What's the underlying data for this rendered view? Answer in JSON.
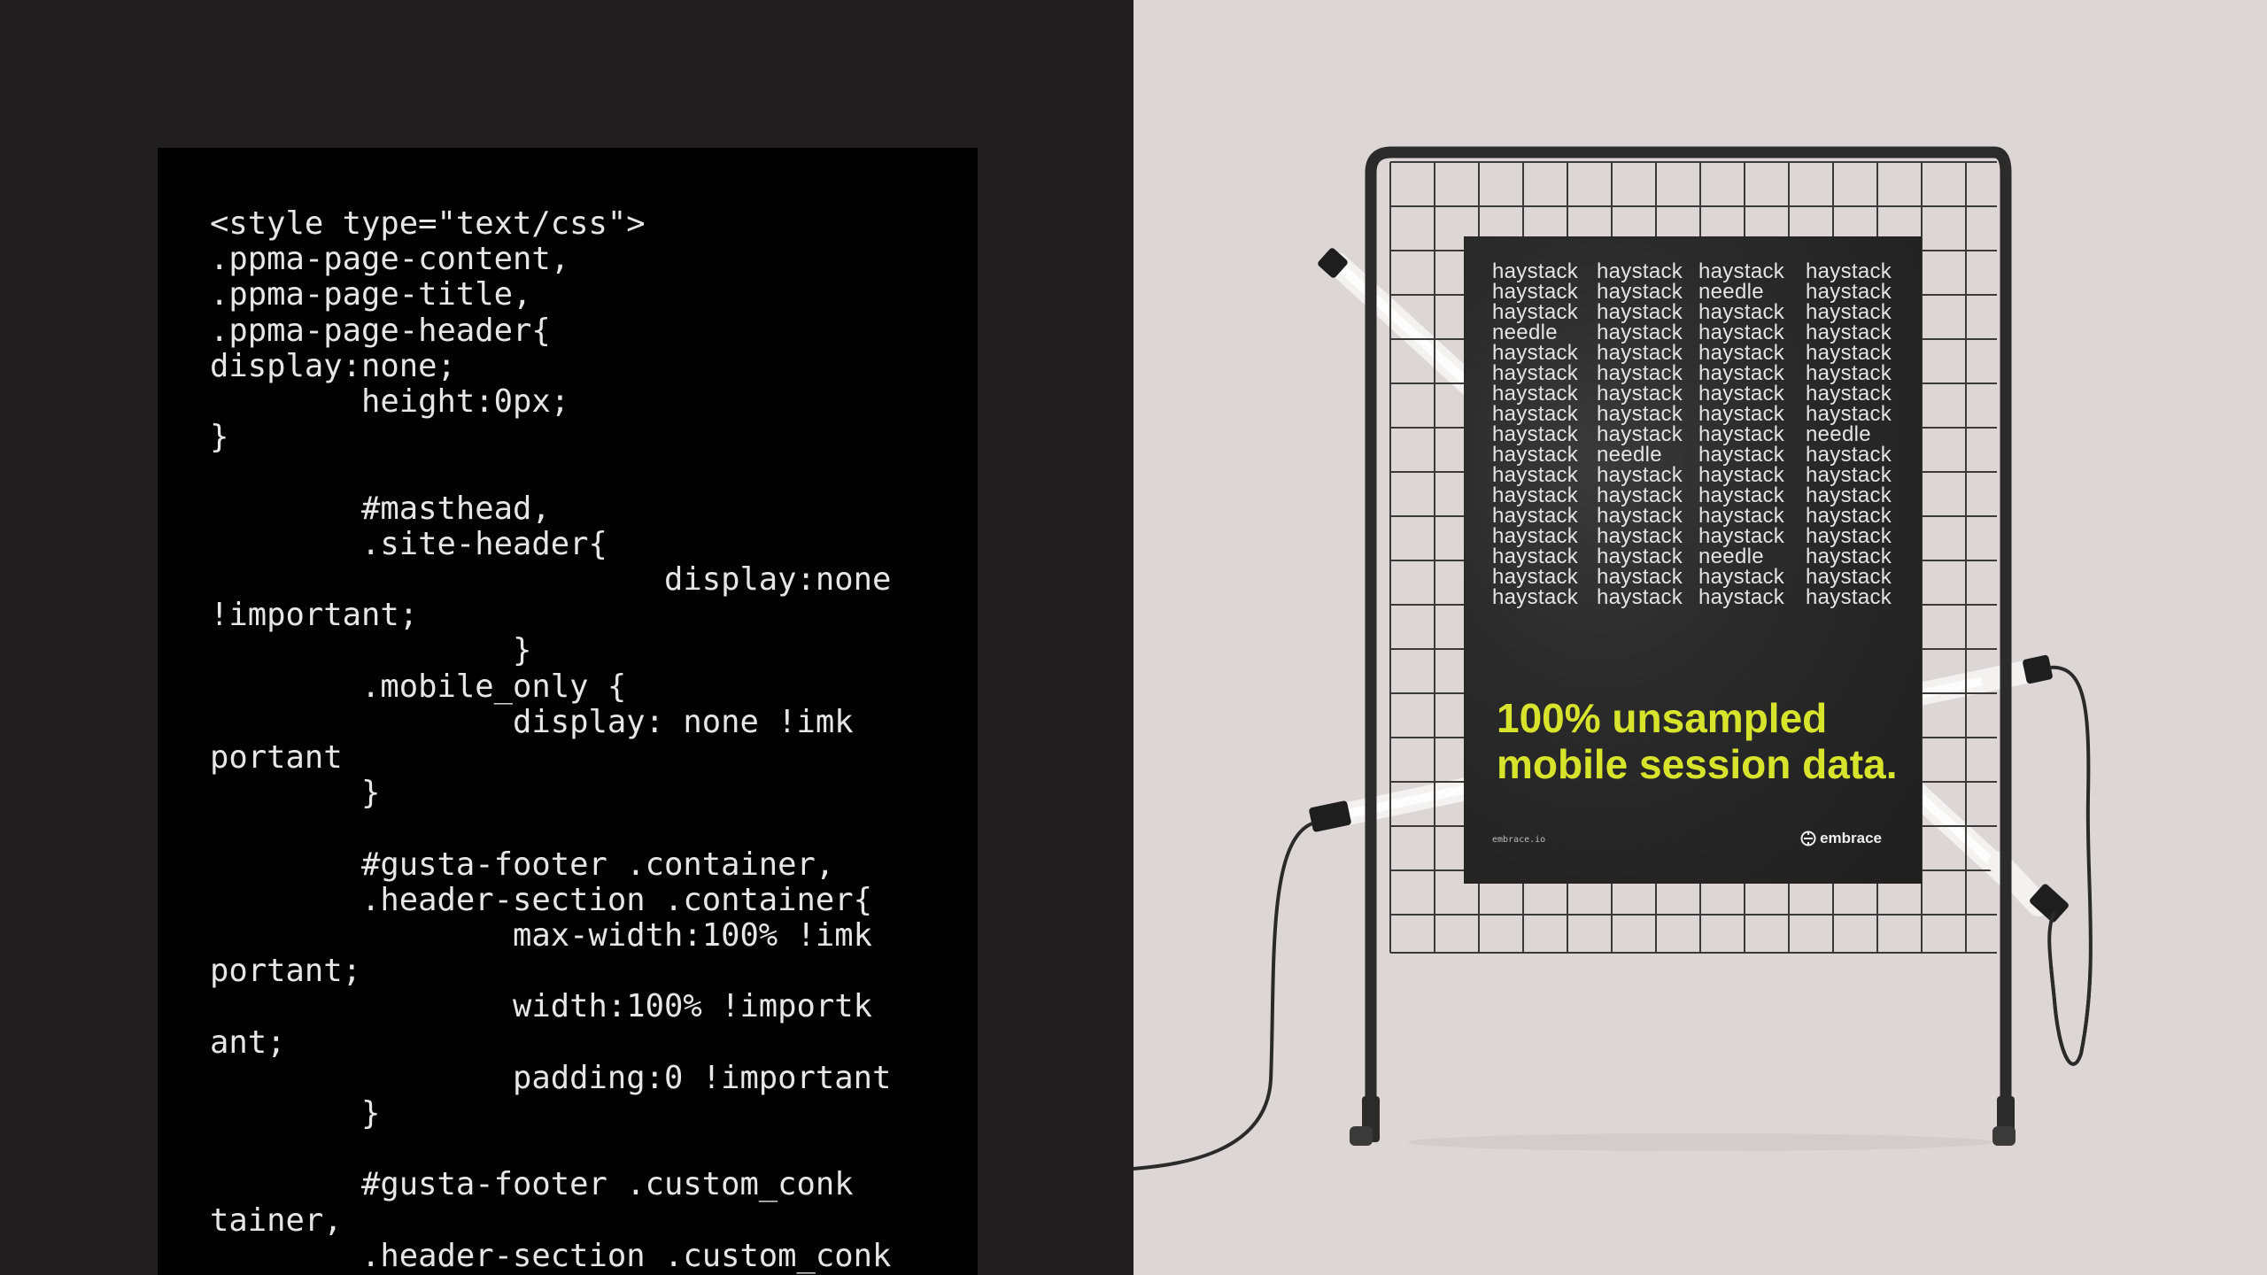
{
  "code_panel": {
    "lines": [
      "<style type=\"text/css\">",
      ".ppma-page-content,",
      ".ppma-page-title,",
      ".ppma-page-header{",
      "display:none;",
      "        height:0px;",
      "}",
      "",
      "        #masthead,",
      "        .site-header{",
      "                        display:none",
      "!important;",
      "                }",
      "        .mobile_only {",
      "                display: none !imk",
      "portant",
      "        }",
      "",
      "        #gusta-footer .container,",
      "        .header-section .container{",
      "                max-width:100% !imk",
      "portant;",
      "                width:100% !importk",
      "ant;",
      "                padding:0 !important",
      "        }",
      "",
      "        #gusta-footer .custom_conk",
      "tainer,",
      "        .header-section .custom_conk"
    ]
  },
  "poster": {
    "words": [
      [
        "haystack",
        "haystack",
        "haystack",
        "haystack"
      ],
      [
        "haystack",
        "haystack",
        "needle",
        "haystack"
      ],
      [
        "haystack",
        "haystack",
        "haystack",
        "haystack"
      ],
      [
        "needle",
        "haystack",
        "haystack",
        "haystack"
      ],
      [
        "haystack",
        "haystack",
        "haystack",
        "haystack"
      ],
      [
        "haystack",
        "haystack",
        "haystack",
        "haystack"
      ],
      [
        "haystack",
        "haystack",
        "haystack",
        "haystack"
      ],
      [
        "haystack",
        "haystack",
        "haystack",
        "haystack"
      ],
      [
        "haystack",
        "haystack",
        "haystack",
        "needle"
      ],
      [
        "haystack",
        "needle",
        "haystack",
        "haystack"
      ],
      [
        "haystack",
        "haystack",
        "haystack",
        "haystack"
      ],
      [
        "haystack",
        "haystack",
        "haystack",
        "haystack"
      ],
      [
        "haystack",
        "haystack",
        "haystack",
        "haystack"
      ],
      [
        "haystack",
        "haystack",
        "haystack",
        "haystack"
      ],
      [
        "haystack",
        "haystack",
        "needle",
        "haystack"
      ],
      [
        "haystack",
        "haystack",
        "haystack",
        "haystack"
      ],
      [
        "haystack",
        "haystack",
        "haystack",
        "haystack"
      ]
    ],
    "headline_line1": "100% unsampled",
    "headline_line2": "mobile session data.",
    "url": "embrace.io",
    "brand": "embrace",
    "brand_icon": "embrace-logo-icon"
  },
  "colors": {
    "left_background": "#211e1f",
    "code_background": "#000000",
    "code_text": "#e6e6e6",
    "right_background": "#dcd6d4",
    "poster_background": "#262626",
    "headline": "#d8e42c",
    "frame": "#2b2b2b"
  }
}
